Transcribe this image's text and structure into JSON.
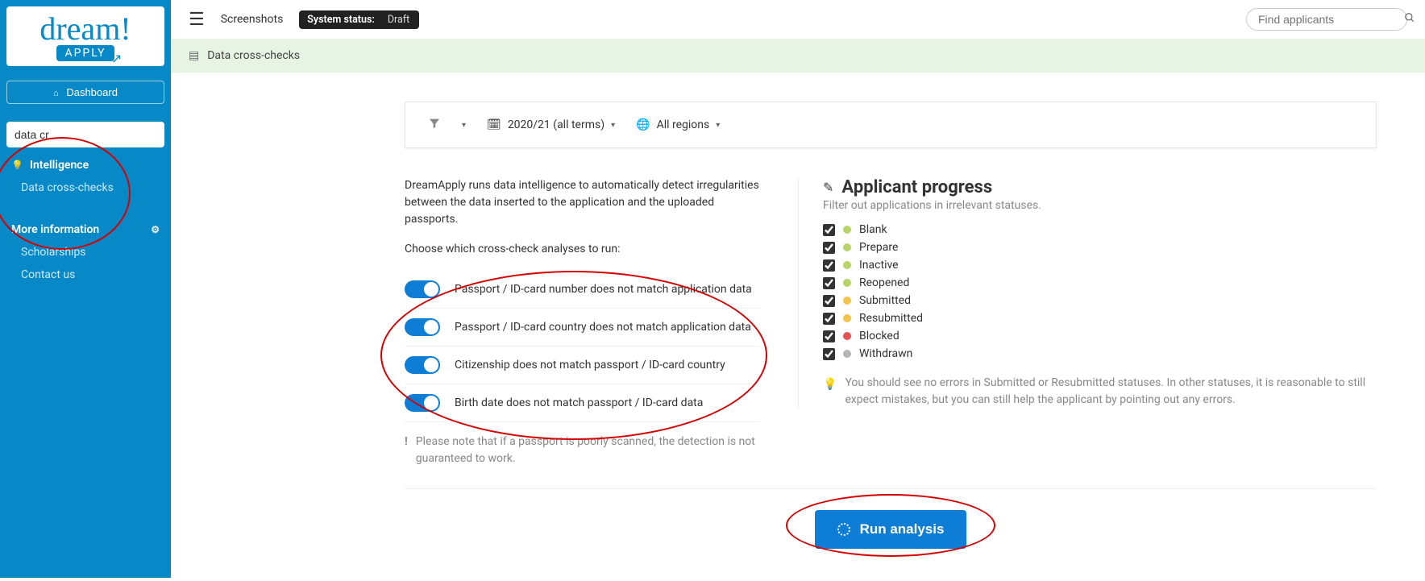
{
  "sidebar": {
    "dashboard_label": "Dashboard",
    "search_value": "data cr",
    "nav_intelligence": "Intelligence",
    "nav_data_cross_checks": "Data cross-checks",
    "section_more_info": "More information",
    "nav_scholarships": "Scholarships",
    "nav_contact_us": "Contact us"
  },
  "topbar": {
    "screenshots_label": "Screenshots",
    "system_status_label": "System status:",
    "system_status_value": "Draft",
    "find_placeholder": "Find applicants"
  },
  "breadcrumb": {
    "title": "Data cross-checks"
  },
  "filter": {
    "term": "2020/21 (all terms)",
    "region": "All regions"
  },
  "analysis": {
    "intro": "DreamApply runs data intelligence to automatically detect irregularities between the data inserted to the application and the uploaded passports.",
    "choose": "Choose which cross-check analyses to run:",
    "options": [
      "Passport / ID-card number does not match application data",
      "Passport / ID-card country does not match application data",
      "Citizenship does not match passport / ID-card country",
      "Birth date does not match passport / ID-card data"
    ],
    "note": "Please note that if a passport is poorly scanned, the detection is not guaranteed to work."
  },
  "progress": {
    "title": "Applicant progress",
    "subtitle": "Filter out applications in irrelevant statuses.",
    "statuses": [
      {
        "label": "Blank",
        "color": "#b7d36a"
      },
      {
        "label": "Prepare",
        "color": "#b7d36a"
      },
      {
        "label": "Inactive",
        "color": "#b7d36a"
      },
      {
        "label": "Reopened",
        "color": "#b7d36a"
      },
      {
        "label": "Submitted",
        "color": "#f3c44b"
      },
      {
        "label": "Resubmitted",
        "color": "#f3c44b"
      },
      {
        "label": "Blocked",
        "color": "#e55353"
      },
      {
        "label": "Withdrawn",
        "color": "#b5b5b5"
      }
    ],
    "tip": "You should see no errors in Submitted or Resubmitted statuses. In other statuses, it is reasonable to still expect mistakes, but you can still help the applicant by pointing out any errors."
  },
  "actions": {
    "run_label": "Run analysis"
  }
}
